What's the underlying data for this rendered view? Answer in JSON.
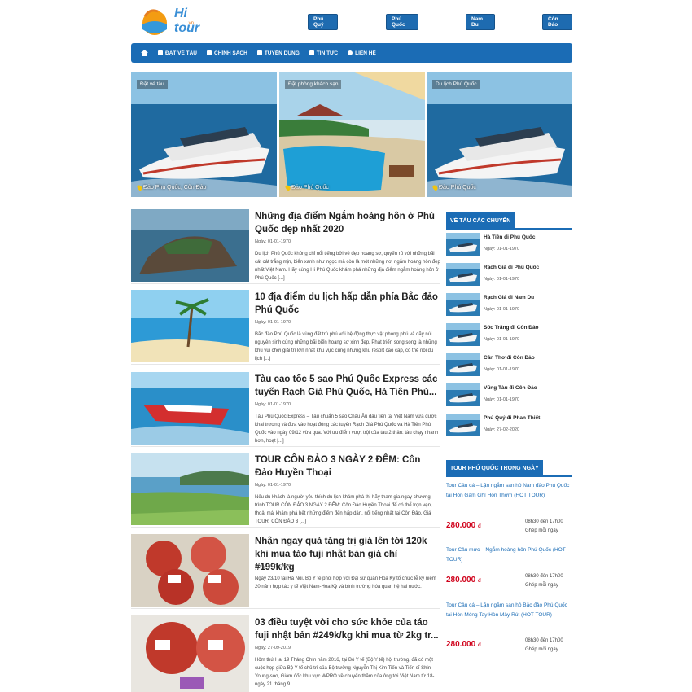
{
  "header": {
    "logo_text": "Hi tour",
    "logo_sub": ".vn",
    "top_buttons": [
      "Phú Quý",
      "Phú Quốc",
      "Nam Du",
      "Côn Đảo"
    ]
  },
  "nav": {
    "items": [
      "ĐẶT VÉ TÀU",
      "CHÍNH SÁCH",
      "TUYỂN DỤNG",
      "TIN TỨC",
      "LIÊN HỆ"
    ]
  },
  "banners": [
    {
      "tag": "Đặt vé tàu",
      "location": "Đảo Phú Quốc, Côn Đảo"
    },
    {
      "tag": "Đặt phòng khách sạn",
      "location": "Đảo Phú Quốc"
    },
    {
      "tag": "Du lịch Phú Quốc",
      "location": "Đảo Phú Quốc"
    }
  ],
  "articles": [
    {
      "title": "Những địa điểm Ngắm hoàng hôn ở Phú Quốc đẹp nhất 2020",
      "date": "Ngày: 01-01-1970",
      "excerpt": "Du lịch Phú Quốc không chỉ nổi tiếng bởi vẻ đẹp hoang sơ, quyến rũ với những bãi cát cát trắng mịn, biển xanh như ngọc mà còn là một những nơi ngắm hoàng hôn đẹp nhất Việt Nam. Hãy cùng Hi Phú Quốc khám phá những địa điểm ngắm hoàng hôn ở Phú Quốc [...]"
    },
    {
      "title": "10 địa điểm du lịch hấp dẫn phía Bắc đảo Phú Quốc",
      "date": "Ngày: 01-01-1970",
      "excerpt": "Bắc đảo Phú Quốc là vùng đất trù phú với hệ động thực vật phong phú và dãy núi nguyên sinh cùng những bãi biển hoang sơ xinh đẹp. Phát triển song song là những khu vui chơi giải trí lớn nhất khu vực cùng những khu resort cao cấp, có thể nói du lịch [...]"
    },
    {
      "title": "Tàu cao tốc 5 sao Phú Quốc Express các tuyến Rạch Giá Phú Quốc, Hà Tiên Phú...",
      "date": "Ngày: 01-01-1970",
      "excerpt": "Tàu Phú Quốc Express – Tàu chuẩn 5 sao Châu Âu đầu tiên tại Việt Nam vừa được khai trương và đưa vào hoạt động các tuyến Rạch Giá Phú Quốc và Hà Tiên Phú Quốc vào ngày 09/12 vừa qua. Với ưu điểm vượt trội của tàu 2 thân: tàu chạy nhanh hơn, hoạt [...]"
    },
    {
      "title": "TOUR CÔN ĐẢO 3 NGÀY 2 ĐÊM: Côn Đảo Huyền Thoại",
      "date": "Ngày: 01-01-1970",
      "excerpt": "Nếu du khách là người yêu thích du lịch khám phá thì hãy tham gia ngay chương trình TOUR CÔN ĐẢO 3 NGÀY 2 ĐÊM: Côn Đảo Huyền Thoại để có thể trọn vẹn, thoải mái khám phá hết những điểm đến hấp dẫn, nổi tiếng nhất tại Côn Đảo. Giá TOUR: CÔN ĐẢO 3 [...]"
    },
    {
      "title": "Nhận ngay quà tặng trị giá lên tới 120k khi mua táo fuji nhật bản giá chỉ #199k/kg",
      "date": "Ngày: 01-01-1970",
      "excerpt": "Ngày 23/10 tại Hà Nội, Bộ Y tế phối hợp với Đại sứ quán Hoa Kỳ tổ chức lễ kỷ niệm 20 năm hợp tác y tế Việt Nam-Hoa Kỳ và bình trường hóa quan hệ hai nước."
    },
    {
      "title": "03 điều tuyệt vời cho sức khỏe của táo fuji nhật bản #249k/kg khi mua từ 2kg tr...",
      "date": "Ngày: 27-09-2019",
      "excerpt": "Hôm thứ Hai 19 Tháng Chín năm 2016, tại Bộ Y tế (Bộ Y tế) hội trường, đã có một cuộc họp giữa Bộ Y tế chủ trì của Bộ trưởng Nguyễn Thị Kim Tiến và Tiến sĩ Shin Young-soo, Giám đốc khu vực WPRO về chuyến thăm của ông tới Việt Nam từ 18-ngày 21 tháng 9"
    }
  ],
  "sidebar": {
    "routes_title": "VÉ TÀU CÁC CHUYẾN",
    "routes": [
      {
        "name": "Hà Tiên đi Phú Quốc",
        "date": "Ngày: 01-01-1970"
      },
      {
        "name": "Rạch Giá đi Phú Quốc",
        "date": "Ngày: 01-01-1970"
      },
      {
        "name": "Rạch Giá đi Nam Du",
        "date": "Ngày: 01-01-1970"
      },
      {
        "name": "Sóc Trăng đi Côn Đảo",
        "date": "Ngày: 01-01-1970"
      },
      {
        "name": "Cần Thơ đi Côn Đảo",
        "date": "Ngày: 01-01-1970"
      },
      {
        "name": "Vũng Tàu đi Côn Đảo",
        "date": "Ngày: 01-01-1970"
      },
      {
        "name": "Phú Quý đi Phan Thiết",
        "date": "Ngày: 27-02-2020"
      }
    ],
    "tours_title": "TOUR PHÚ QUỐC TRONG NGÀY",
    "tours": [
      {
        "name": "Tour Câu cá – Lặn ngắm san hô Nam đảo Phú Quốc tại Hòn Gầm Ghì Hòn Thơm (HOT TOUR)",
        "price": "280.000",
        "currency": "đ",
        "time": "08h30 đến 17h00",
        "join": "Ghép mỗi ngày"
      },
      {
        "name": "Tour Câu mực – Ngắm hoàng hôn Phú Quốc (HOT TOUR)",
        "price": "280.000",
        "currency": "đ",
        "time": "08h30 đến 17h00",
        "join": "Ghép mỗi ngày"
      },
      {
        "name": "Tour Câu cá – Lặn ngắm san hô Bắc đảo Phú Quốc tại Hòn Móng Tay Hòn Mây Rút (HOT TOUR)",
        "price": "280.000",
        "currency": "đ",
        "time": "08h30 đến 17h00",
        "join": "Ghép mỗi ngày"
      }
    ]
  },
  "colors": {
    "primary": "#1b6cb5",
    "price": "#d0021b"
  }
}
